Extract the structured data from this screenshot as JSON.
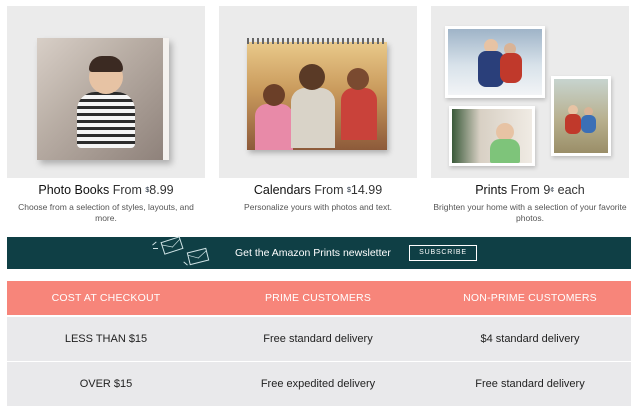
{
  "products": [
    {
      "name": "Photo Books",
      "from_text": "From",
      "currency": "$",
      "price": "8.99",
      "suffix": "",
      "description": "Choose from a selection of styles, layouts, and more."
    },
    {
      "name": "Calendars",
      "from_text": "From",
      "currency": "$",
      "price": "14.99",
      "suffix": "",
      "description": "Personalize yours with photos and text."
    },
    {
      "name": "Prints",
      "from_text": "From",
      "currency": "",
      "price": "9",
      "price_unit": "¢",
      "suffix": "each",
      "description": "Brighten your home with a selection of your favorite photos."
    }
  ],
  "newsletter": {
    "text": "Get the Amazon Prints newsletter",
    "button_label": "SUBSCRIBE",
    "icon": "envelope-icon",
    "background": "#0f3f45"
  },
  "shipping_table": {
    "header_color": "#f7857a",
    "row_color": "#e9e9eb",
    "headers": [
      "COST AT CHECKOUT",
      "PRIME CUSTOMERS",
      "NON-PRIME CUSTOMERS"
    ],
    "rows": [
      [
        "LESS THAN $15",
        "Free standard delivery",
        "$4 standard delivery"
      ],
      [
        "OVER $15",
        "Free expedited delivery",
        "Free standard delivery"
      ]
    ]
  }
}
